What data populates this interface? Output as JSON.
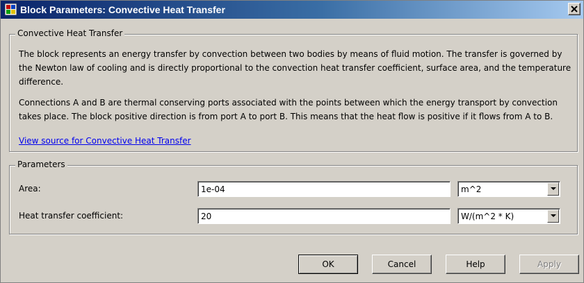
{
  "window": {
    "title": "Block Parameters: Convective Heat Transfer"
  },
  "description_group": {
    "title": "Convective Heat Transfer",
    "paragraph1": "The block represents an energy transfer by convection between two bodies by means of fluid motion. The transfer is governed by the Newton law of cooling and is directly proportional to the convection heat transfer coefficient, surface area, and the temperature difference.",
    "paragraph2": "Connections A and B are thermal conserving ports associated with the points between which the energy transport by convection takes place. The block positive direction is from port A to port B. This means that the heat flow is positive if it flows from A to B.",
    "source_link": "View source for Convective Heat Transfer"
  },
  "parameters_group": {
    "title": "Parameters",
    "fields": [
      {
        "label": "Area:",
        "value": "1e-04",
        "unit": "m^2"
      },
      {
        "label": "Heat transfer coefficient:",
        "value": "20",
        "unit": "W/(m^2 * K)"
      }
    ]
  },
  "buttons": {
    "ok": "OK",
    "cancel": "Cancel",
    "help": "Help",
    "apply": "Apply"
  },
  "icons": {
    "app": "simulink-block-icon",
    "close": "close-icon",
    "dropdown": "dropdown-arrow-icon"
  },
  "colors": {
    "titlebar_start": "#0a246a",
    "titlebar_end": "#a6caf0",
    "link": "#0000ee",
    "face": "#d4d0c8"
  }
}
